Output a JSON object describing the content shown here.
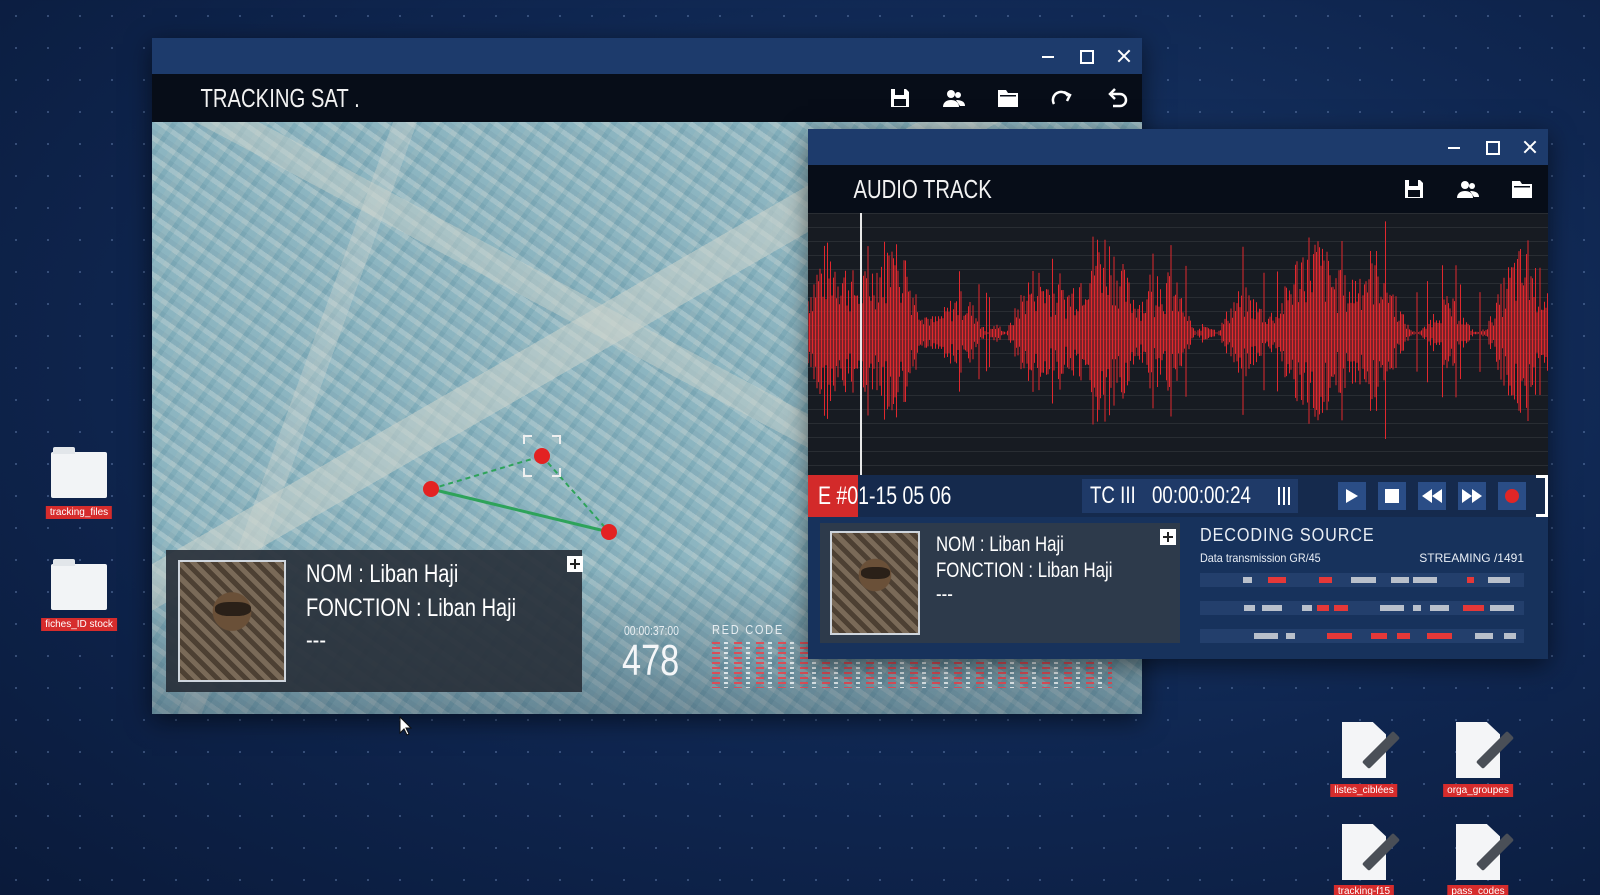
{
  "colors": {
    "accent_red": "#d32a2a",
    "window_blue": "#1d3b6c",
    "header_black": "#070d18",
    "waveform": "#e0282e",
    "seg_red": "#e53838",
    "seg_grey": "#b9c0cb"
  },
  "tracking_window": {
    "title": "TRACKING SAT .",
    "window_controls": [
      "minimize-icon",
      "maximize-icon",
      "close-icon"
    ],
    "toolbar_icons": [
      "save-icon",
      "users-icon",
      "folder-icon",
      "redo-icon",
      "undo-icon"
    ],
    "profile_card": {
      "nom": "NOM : Liban Haji",
      "fonction": "FONCTION : Liban Haji",
      "extra": "---"
    },
    "timecode": "00:00:37:00",
    "counter": "478",
    "red_code_label": "RED CODE"
  },
  "audio_window": {
    "title": "AUDIO TRACK",
    "window_controls": [
      "minimize-icon",
      "maximize-icon",
      "close-icon"
    ],
    "toolbar_icons": [
      "save-icon",
      "users-icon",
      "folder-icon"
    ],
    "episode": "E #01-15 05 06",
    "tc_label": "TC III",
    "tc_value": "00:00:00:24",
    "transport_buttons": [
      "play-icon",
      "stop-icon",
      "rewind-icon",
      "fast-forward-icon",
      "record-icon"
    ],
    "profile_card": {
      "nom": "NOM : Liban Haji",
      "fonction": "FONCTION : Liban Haji",
      "extra": "---"
    },
    "decoding": {
      "title": "DECODING SOURCE",
      "subtitle": "Data transmission GR/45",
      "streaming": "STREAMING /1491"
    }
  },
  "desktop": {
    "folders": [
      {
        "label": "tracking_files"
      },
      {
        "label": "fiches_ID stock"
      }
    ],
    "files": [
      {
        "label": "listes_ciblées"
      },
      {
        "label": "orga_groupes"
      },
      {
        "label": "tracking-f15"
      },
      {
        "label": "pass_codes"
      }
    ]
  }
}
